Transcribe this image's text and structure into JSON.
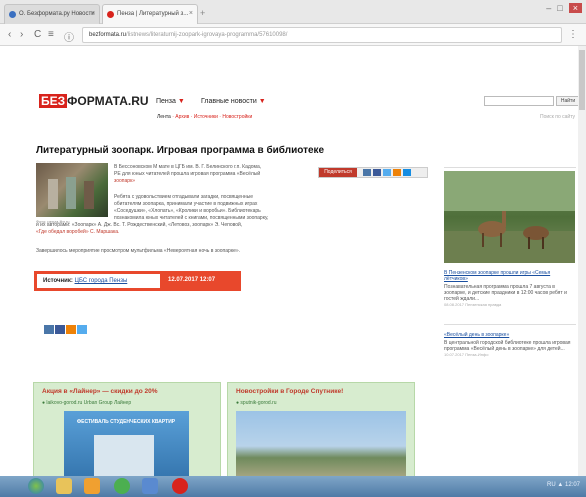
{
  "browser": {
    "tabs": [
      {
        "title": "О. Безформата.ру Новости",
        "fav": "#3a6fc0"
      },
      {
        "title": "Пенза | Литературный з...",
        "fav": "#d8231c"
      }
    ],
    "url_host": "bezformata.ru",
    "url_rest": "/listnews/literaturnij-zoopark-igrovaya-programma/57610098/",
    "new_tab": "+",
    "back": "‹",
    "forward": "›",
    "reload": "C",
    "home": "≡",
    "info": "ⓘ",
    "menu": "⋮"
  },
  "site": {
    "logo_red": "БЕЗ",
    "logo_rest": "ФОРМАТА.RU",
    "nav_city": "Пенза",
    "nav_news": "Главные новости",
    "arrow": "▼",
    "subnav": [
      "Лента",
      "Архив",
      "Источники",
      "Новостройки"
    ],
    "search_button": "Найти",
    "search_hint": "Поиск по сайту"
  },
  "article": {
    "title": "Литературный зоопарк. Игровая программа в библиотеке",
    "photo_caption": "Фото: penza-libr.ru",
    "lead": [
      "В Бессоновском М мате в ЦГБ им. В. Г. Белинского г.п. Кадома,",
      "РЕ для юных читателей прошла игровая программа «Весёлый",
      "зоопарк»"
    ],
    "body": [
      "Ребята с удовольствием отгадывали загадки, посвященные",
      "обитателям зоопарка, принимали участие в подвижных играх",
      "«Соседушки», «Хлопать», «Кролики и воробьи». Библиотекарь",
      "познакомила юных читателей с книгами, посвященными зоопарку,",
      "и их авторами: «Зоопарк»  А. Дж. Вс. Т. Рождественский, «Летовоз, зоопарк» Э. Чеповой,",
      "«Где обедал воробей» С. Маршака."
    ],
    "footer": "Завершилось мероприятие просмотром мультфильма «Невероятная ночь в зоопарке».",
    "share_label": "Поделиться",
    "source_label": "Источник:",
    "source_name": "ЦБС города Пензы",
    "date": "12.07.2017  12:07"
  },
  "sidebar": {
    "story1_title": "В Пензенском зоопарке прошли игры «Семья лётчиков»",
    "story1_text": "Познавательная программа прошла 7 августа в зоопарке, и детские праздники в 12:00 часов ребят и гостей ждали...",
    "story1_date": "08.08.2017 Пензенская правда",
    "story2_title": "«Весёлый день в зоопарке»",
    "story2_text": "В центральной городской библиотеке прошла игровая программа «Весёлый день в зоопарке» для детей...",
    "story2_date": "10.07.2017 Пенза-Инфо"
  },
  "ads": [
    {
      "title": "Акция в «Лайнер» — скидки до 20%",
      "sub": "● laikovo-gorod.ru Urban Group Лайнер",
      "caption": "ФЕСТИВАЛЬ СТУДЕНЧЕСКИХ КВАРТИР"
    },
    {
      "title": "Новостройки в Городе Спутнике!",
      "sub": "● sputnik-gorod.ru",
      "caption": ""
    }
  ],
  "taskbar": {
    "tray": "RU ▲ 12:07"
  },
  "colors": {
    "brand": "#d8231c",
    "link": "#1a4fa0"
  }
}
